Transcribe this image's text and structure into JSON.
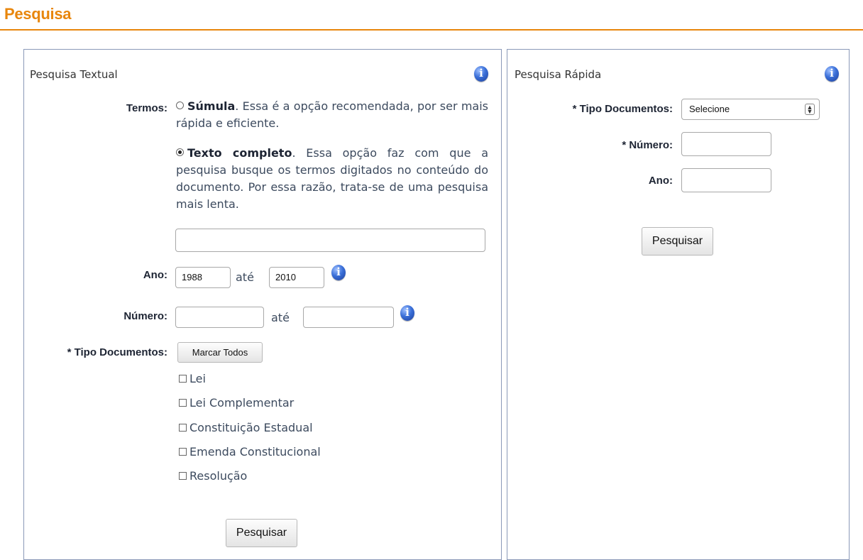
{
  "header": {
    "title": "Pesquisa"
  },
  "textual": {
    "heading": "Pesquisa Textual",
    "termos_label": "Termos:",
    "sumula_label": "Súmula",
    "sumula_desc": ". Essa é a opção recomendada, por ser mais rápida e eficiente.",
    "texto_label": "Texto completo",
    "texto_desc": ". Essa opção faz com que a pesquisa busque os termos digitados no conteúdo do documento. Por essa razão, trata-se de uma pesquisa mais lenta.",
    "termos_value": "",
    "ano_label": "Ano:",
    "ano_from": "1988",
    "ano_to": "2010",
    "ate": "até",
    "numero_label": "Número:",
    "numero_from": "",
    "numero_to": "",
    "tipo_label": "* Tipo Documentos:",
    "marcar_todos": "Marcar Todos",
    "doc_types": [
      "Lei",
      "Lei Complementar",
      "Constituição Estadual",
      "Emenda Constitucional",
      "Resolução"
    ],
    "search_button": "Pesquisar"
  },
  "rapida": {
    "heading": "Pesquisa Rápida",
    "tipo_label": "* Tipo Documentos:",
    "tipo_selected": "Selecione",
    "numero_label": "* Número:",
    "numero_value": "",
    "ano_label": "Ano:",
    "ano_value": "",
    "search_button": "Pesquisar"
  },
  "colors": {
    "accent": "#e8860c",
    "panel_border": "#8a99b8",
    "info_blue": "#2f5fc4"
  },
  "icons": {
    "info": "info-icon",
    "select_arrow": "updown-arrow-icon"
  }
}
